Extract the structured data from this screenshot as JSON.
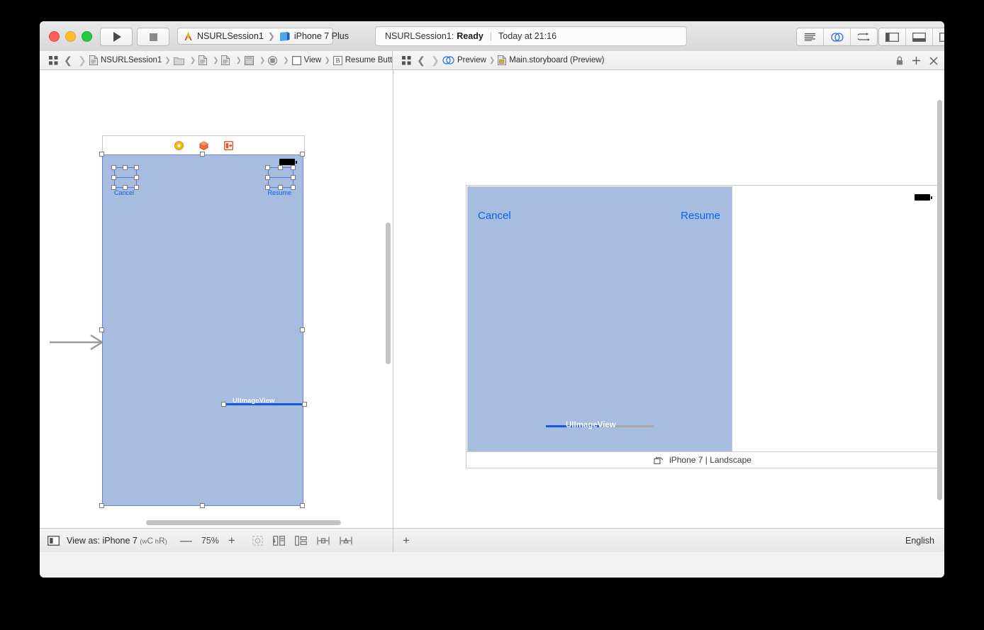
{
  "window": {
    "traffic_lights": [
      "close",
      "minimize",
      "zoom"
    ],
    "toolbar": {
      "run_label": "Run",
      "stop_label": "Stop",
      "scheme_name": "NSURLSession1",
      "scheme_destination": "iPhone 7 Plus",
      "status_project": "NSURLSession1:",
      "status_state": "Ready",
      "status_time": "Today at 21:16",
      "editor_buttons": [
        "standard-editor",
        "assistant-editor",
        "version-editor"
      ],
      "panel_buttons": [
        "navigator-toggle",
        "debug-area-toggle",
        "utilities-toggle"
      ]
    }
  },
  "jumpbar_left": {
    "related_items_label": "Related Items",
    "back_label": "Back",
    "forward_label": "Forward",
    "crumbs": [
      {
        "label": "NSURLSession1",
        "icon": "project-document-icon"
      },
      {
        "label": "",
        "icon": "folder-icon"
      },
      {
        "label": "",
        "icon": "document-icon"
      },
      {
        "label": "",
        "icon": "document-icon"
      },
      {
        "label": "",
        "icon": "storyboard-scene-icon"
      },
      {
        "label": "",
        "icon": "view-controller-icon"
      },
      {
        "label": "View",
        "icon": "view-icon"
      },
      {
        "label": "Resume Button",
        "icon": "button-icon"
      }
    ]
  },
  "jumpbar_right": {
    "related_items_label": "Related Items",
    "back_label": "Back",
    "forward_label": "Forward",
    "crumbs": [
      {
        "label": "Preview",
        "icon": "assistant-editor-icon"
      },
      {
        "label": "Main.storyboard (Preview)",
        "icon": "storyboard-document-icon"
      }
    ],
    "icons": [
      "lock-icon",
      "plus-icon",
      "close-icon"
    ]
  },
  "canvas": {
    "scene_dock_icons": [
      "view-controller-dock-icon",
      "first-responder-dock-icon",
      "exit-dock-icon"
    ],
    "cancel_button_label": "Cancel",
    "resume_button_label": "Resume",
    "image_view_label": "UIImageView",
    "entry_point_arrow": "storyboard-entry-point-arrow"
  },
  "preview": {
    "cancel_button_label": "Cancel",
    "resume_button_label": "Resume",
    "image_view_label": "UIImageView",
    "device_caption": "iPhone 7 | Landscape",
    "rotate_icon": "rotate-device-icon",
    "annotation": "red-highlight-circle"
  },
  "bottombar": {
    "document_outline_label": "Document Outline",
    "view_as_label": "View as: iPhone 7",
    "view_as_traits_w": "w",
    "view_as_traits_wc": "C",
    "view_as_traits_h": "h",
    "view_as_traits_hr": "R",
    "zoom_out_label": "—",
    "zoom_level": "75%",
    "zoom_in_label": "+",
    "autolayout_buttons": [
      "update-frames-icon",
      "embed-in-icon",
      "resolve-auto-layout-issues-icon",
      "align-icon",
      "add-new-constraints-icon"
    ],
    "preview_add_label": "+",
    "language": "English"
  },
  "colors": {
    "view_fill": "#a6bde0",
    "selection_blue": "#1a57e8",
    "link_blue": "#0a62f0",
    "annotation_red": "#e02020",
    "accent_blue": "#2673d8"
  }
}
